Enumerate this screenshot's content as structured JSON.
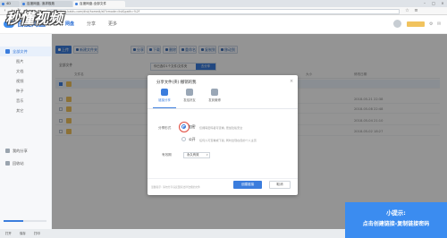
{
  "browser": {
    "tabs": [
      {
        "label": "4D",
        "active": false
      },
      {
        "label": "百度网盘, 追求极致",
        "active": false
      },
      {
        "label": "百度网盘-全部文件",
        "active": true
      }
    ],
    "url": "https://pan.baidu.com/disk/home#/all?vmode=list&path=%2F"
  },
  "app": {
    "name": "百度网盘",
    "nav": [
      "网盘",
      "分享",
      "更多"
    ]
  },
  "watermark": "秒懂视频",
  "sidebar": {
    "items": [
      {
        "label": "全部文件",
        "active": true
      },
      {
        "label": "我的分享",
        "active": false
      },
      {
        "label": "回收站",
        "active": false
      }
    ],
    "categories": [
      "图片",
      "文档",
      "视频",
      "种子",
      "音乐",
      "其它"
    ],
    "quota_text": "",
    "quota_ratio": 0.45
  },
  "toolbar": {
    "buttons": [
      "上传",
      "新建文件夹",
      "分享",
      "下载",
      "删除",
      "重命名",
      "复制到",
      "移动到"
    ]
  },
  "share_tip": {
    "text": "你已选中1个文件/文件夹",
    "button": "去分享"
  },
  "breadcrumb": "全部文件",
  "list": {
    "headers": [
      "文件名",
      "大小",
      "修改日期"
    ],
    "rows": [
      {
        "name": "",
        "date": "",
        "selected": true
      },
      {
        "name": "",
        "date": "2018-05-21 22:38",
        "selected": false
      },
      {
        "name": "",
        "date": "2018-05-08 22:48",
        "selected": false
      },
      {
        "name": "",
        "date": "2018-05-04 21:10",
        "selected": false
      },
      {
        "name": "",
        "date": "2018-05-02 18:27",
        "selected": false
      }
    ]
  },
  "dialog": {
    "title": "分享文件(夹):撤销的我",
    "close": "×",
    "tabs": [
      "链接分享",
      "发给好友",
      "发到微博"
    ],
    "share_type_label": "分享形式",
    "options": [
      {
        "title": "加密",
        "desc": "仅拥有密码者可查看, 更加隐私安全",
        "checked": true
      },
      {
        "title": "公开",
        "desc": "任何人可查看或下载, 同时出现在您的个人主页",
        "checked": false
      }
    ],
    "validity_label": "有效期",
    "validity_value": "永久有效",
    "note": "温馨提示: 请勿分享违反国家法律法规的文件",
    "create_button": "创建链接",
    "cancel_button": "取消"
  },
  "hint": {
    "title": "小提示:",
    "body": "点击创建链接-复制链接密码"
  },
  "taskbar": [
    "打开",
    "保存",
    "打印"
  ],
  "colors": {
    "accent": "#3b7ddd",
    "hint_bg": "#3b8cf0",
    "highlight": "#e04a3e"
  }
}
